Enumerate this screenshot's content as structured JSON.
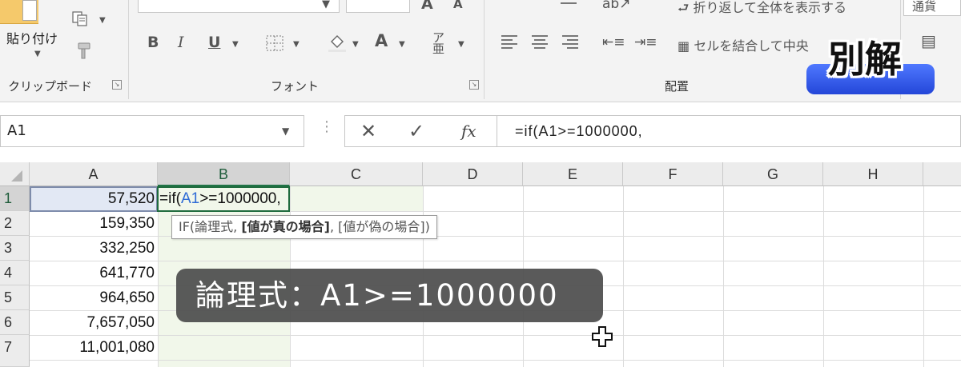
{
  "ribbon": {
    "clipboard": {
      "paste_label": "貼り付け",
      "group_label": "クリップボード"
    },
    "font": {
      "group_label": "フォント"
    },
    "alignment": {
      "group_label": "配置",
      "wrap_text_label": "折り返して全体を表示する",
      "merge_label": "セルを結合して中央"
    },
    "number": {
      "format_value": "通貨"
    }
  },
  "badge": {
    "text": "別解",
    "color": "#3a5ff0"
  },
  "formula_bar": {
    "name_box": "A1",
    "formula": "=if(A1>=1000000,"
  },
  "grid": {
    "columns": [
      "A",
      "B",
      "C",
      "D",
      "E",
      "F",
      "G",
      "H"
    ],
    "rows": [
      "1",
      "2",
      "3",
      "4",
      "5",
      "6",
      "7"
    ],
    "column_a_values": [
      "57,520",
      "159,350",
      "332,250",
      "641,770",
      "964,650",
      "7,657,050",
      "11,001,080"
    ],
    "editing_cell": {
      "prefix": "=if(",
      "ref": "A1",
      "suffix": ">=1000000,"
    },
    "tooltip": {
      "start": "IF(論理式, ",
      "bold_arg": "[値が真の場合]",
      "end": ", [値が偽の場合])"
    }
  },
  "caption": {
    "text": "論理式：A1>=1000000"
  },
  "colors": {
    "accent_green": "#217346",
    "ref_blue": "#2e6bd6"
  }
}
